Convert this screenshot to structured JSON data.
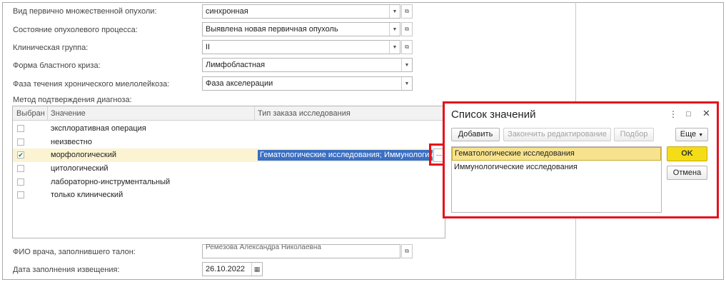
{
  "form": {
    "fields": [
      {
        "label": "Вид первично множественной опухоли:",
        "value": "синхронная"
      },
      {
        "label": "Состояние опухолевого процесса:",
        "value": "Выявлена новая первичная опухоль"
      },
      {
        "label": "Клиническая группа:",
        "value": "II"
      },
      {
        "label": "Форма бластного криза:",
        "value": "Лимфобластная"
      },
      {
        "label": "Фаза течения хронического миелолейкоза:",
        "value": "Фаза акселерации"
      }
    ],
    "method_label": "Метод подтверждения диагноза:",
    "doctor_label": "ФИО врача, заполнившего талон:",
    "doctor_value": "Ремезова Александра Николаевна",
    "date_label": "Дата заполнения извещения:",
    "date_value": "26.10.2022"
  },
  "grid": {
    "columns": [
      "Выбран",
      "Значение",
      "Тип заказа исследования"
    ],
    "rows": [
      {
        "checked": false,
        "value": "эксплоративная операция",
        "order_type": ""
      },
      {
        "checked": false,
        "value": "неизвестно",
        "order_type": ""
      },
      {
        "checked": true,
        "value": "морфологический",
        "order_type": "Гематологические исследования; Иммунологические исследования"
      },
      {
        "checked": false,
        "value": "цитологический",
        "order_type": ""
      },
      {
        "checked": false,
        "value": "лабораторно-инструментальный",
        "order_type": ""
      },
      {
        "checked": false,
        "value": "только клинический",
        "order_type": ""
      }
    ],
    "cell_button": "..."
  },
  "popup": {
    "title": "Список значений",
    "add": "Добавить",
    "finish_edit": "Закончить редактирование",
    "pick": "Подбор",
    "more": "Еще",
    "items": [
      "Гематологические исследования",
      "Иммунологические исследования"
    ],
    "ok": "OK",
    "cancel": "Отмена"
  },
  "icons": {
    "dropdown": "chevron-down-icon",
    "open": "open-form-icon",
    "calendar": "calendar-icon",
    "menu": "more-vert-icon",
    "maximize": "maximize-icon",
    "close": "close-icon"
  },
  "colors": {
    "highlight_frame": "#e3121b",
    "ok_button": "#f4dd17",
    "selected_item": "#f7e38e",
    "selected_row": "#fbf3d2",
    "selected_cell": "#3a6fc4"
  }
}
